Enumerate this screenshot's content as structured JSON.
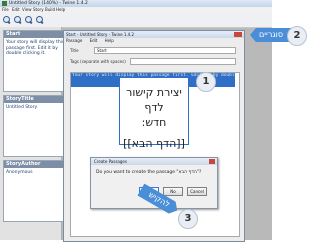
{
  "window": {
    "title": "Untitled Story (140%) - Twine 1.4.2"
  },
  "menu": [
    "File",
    "Edit",
    "View",
    "Story",
    "Build",
    "Help"
  ],
  "toolbar_icons": [
    "zoom-in-icon",
    "zoom-out-icon",
    "zoom-fit-icon",
    "zoom-actual-icon"
  ],
  "cards": [
    {
      "title": "Start",
      "body": "Your story will display this passage first. Edit it by double clicking it."
    },
    {
      "title": "StoryTitle",
      "body": "Untitled Story"
    },
    {
      "title": "StoryAuthor",
      "body": "Anonymous"
    }
  ],
  "editor": {
    "title": "Start - Untitled Story - Twine 1.4.2",
    "menu": [
      "Passage",
      "Edit",
      "Help"
    ],
    "title_label": "Title",
    "title_value": "Start",
    "tags_label": "Tags (separate with spaces)",
    "tags_value": "",
    "selected_text": "Your story will display this passage first. Edit it by double clicking it."
  },
  "hebrew_note": {
    "line1": "יצירת קישור לדף",
    "line2": "חדש:",
    "line3": "[[הדף הבא]]"
  },
  "dialog": {
    "title": "Create Passages",
    "message": "Do you want to create the passage \"הדף הבא\"?",
    "yes_label": "Yes",
    "no_label": "No",
    "cancel_label": "Cancel"
  },
  "callouts": {
    "c1": "1",
    "c2": "2",
    "c3": "3",
    "brackets_label": "סוגריים",
    "click_label": "להקיש"
  },
  "colors": {
    "accent": "#4a8ed8",
    "selection": "#2f6fc6",
    "card_header": "#7d8fa7"
  }
}
